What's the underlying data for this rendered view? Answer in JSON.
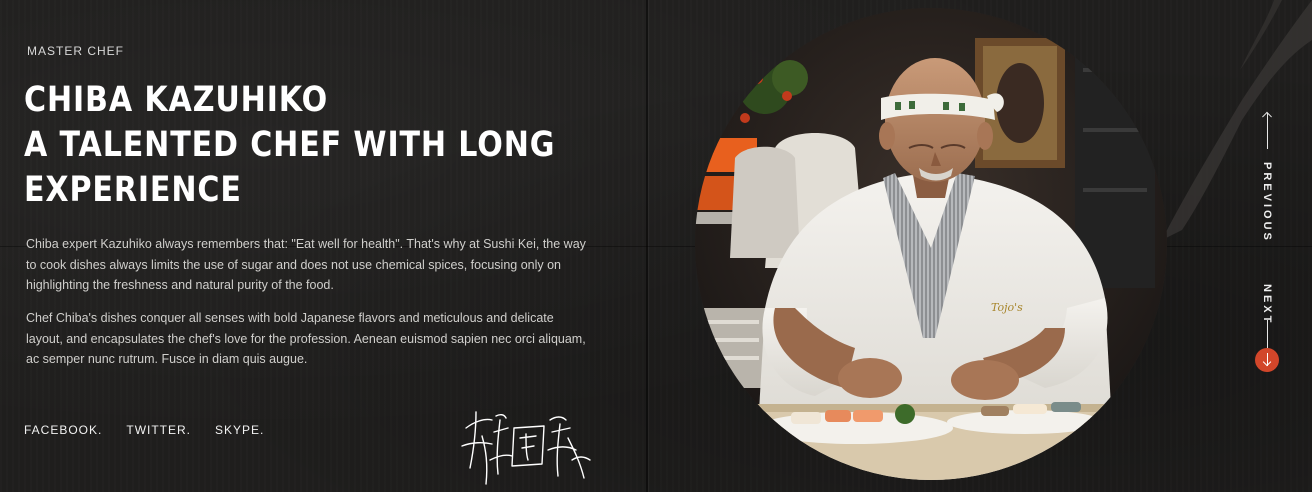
{
  "hero": {
    "eyebrow": "MASTER CHEF",
    "headline_lines": [
      "CHIBA KAZUHIKO",
      "A TALENTED CHEF WITH LONG",
      "EXPERIENCE"
    ],
    "paragraphs": [
      "Chiba expert Kazuhiko always remembers that: \"Eat well for health\". That's why at Sushi Kei, the way to cook dishes always limits the use of sugar and does not use chemical spices, focusing only on highlighting the freshness and natural purity of the food.",
      "Chef Chiba's dishes conquer all senses with bold Japanese flavors and meticulous and delicate layout, and encapsulates the chef's love for the profession. Aenean euismod sapien nec orci aliquam, ac semper nunc rutrum. Fusce in diam quis augue."
    ]
  },
  "social": {
    "links": [
      "FACEBOOK.",
      "TWITTER.",
      "SKYPE."
    ]
  },
  "slider": {
    "previous_label": "PREVIOUS",
    "next_label": "NEXT"
  },
  "icons": {
    "signature": "signature-icon",
    "previous": "arrow-up-icon",
    "next": "arrow-down-icon"
  },
  "colors": {
    "background": "#1f1e1d",
    "text": "#ffffff",
    "muted_text": "#d0cfcc",
    "accent": "#d2462a"
  }
}
